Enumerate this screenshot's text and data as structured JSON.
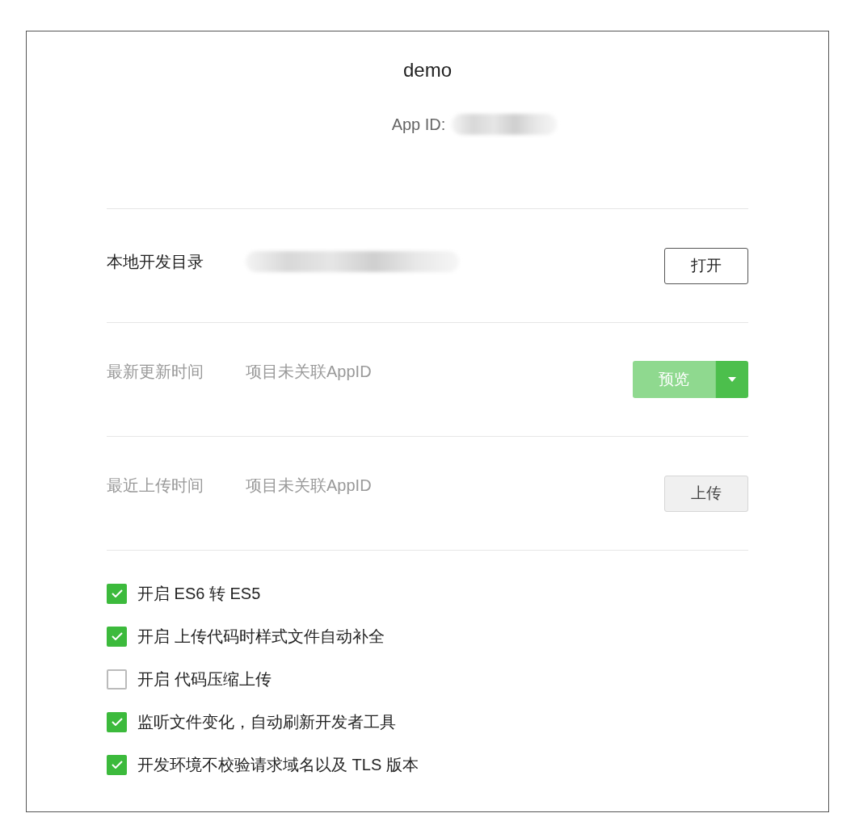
{
  "title": "demo",
  "app_id": {
    "label": "App ID:"
  },
  "rows": [
    {
      "kind": "folder",
      "label": "本地开发目录",
      "button": "打开",
      "disabled": false
    },
    {
      "kind": "preview",
      "label": "最新更新时间",
      "value": "项目未关联AppID",
      "button": "预览",
      "disabled": true
    },
    {
      "kind": "upload",
      "label": "最近上传时间",
      "value": "项目未关联AppID",
      "button": "上传",
      "disabled": true
    }
  ],
  "options": [
    {
      "label": "开启 ES6 转 ES5",
      "checked": true
    },
    {
      "label": "开启 上传代码时样式文件自动补全",
      "checked": true
    },
    {
      "label": "开启 代码压缩上传",
      "checked": false
    },
    {
      "label": "监听文件变化，自动刷新开发者工具",
      "checked": true
    },
    {
      "label": "开发环境不校验请求域名以及 TLS 版本",
      "checked": true
    }
  ]
}
